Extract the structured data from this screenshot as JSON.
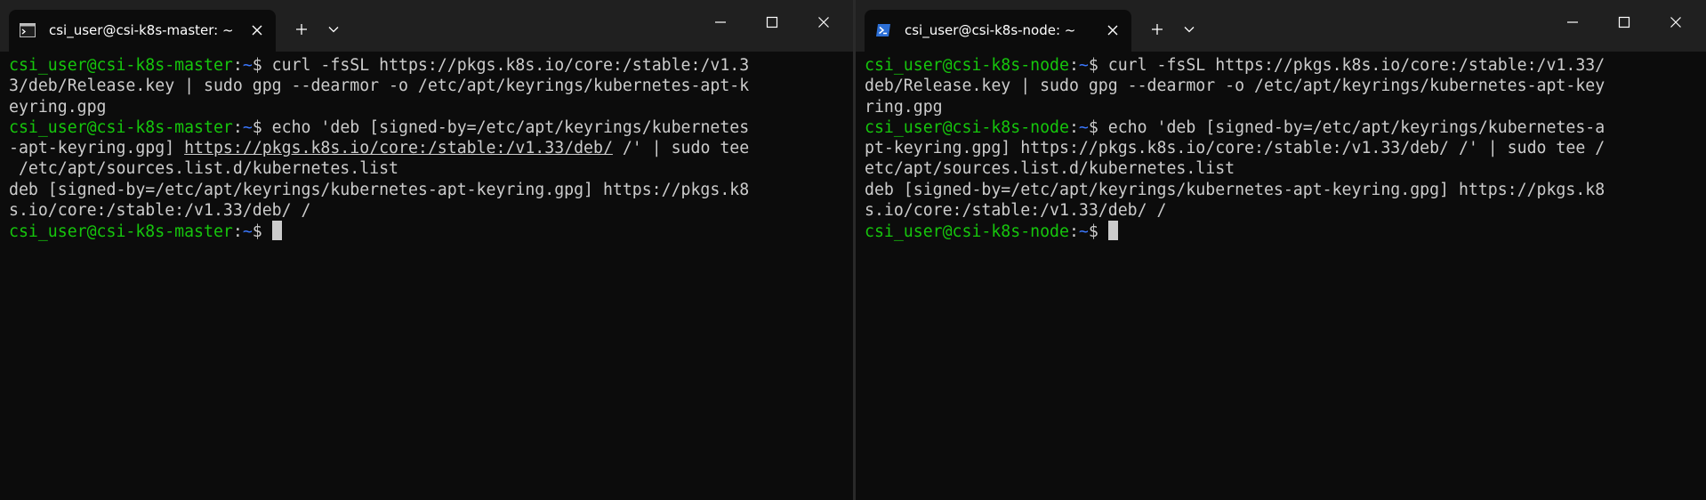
{
  "colors": {
    "background": "#0c0c0c",
    "titlebar": "#202020",
    "prompt_user": "#16c60c",
    "prompt_path": "#3b78ff",
    "text": "#cccccc"
  },
  "left": {
    "tab_title": "csi_user@csi-k8s-master: ~",
    "tab_icon": "terminal-icon",
    "prompt": {
      "user": "csi_user@csi-k8s-master",
      "sep": ":",
      "path": "~",
      "symbol": "$ "
    },
    "lines": [
      {
        "seg": [
          {
            "k": "u",
            "t": "csi_user@csi-k8s-master"
          },
          {
            "k": "w",
            "t": ":"
          },
          {
            "k": "p",
            "t": "~"
          },
          {
            "k": "w",
            "t": "$ curl -fsSL https://pkgs.k8s.io/core:/stable:/v1.3"
          }
        ]
      },
      {
        "seg": [
          {
            "k": "w",
            "t": "3/deb/Release.key | sudo gpg --dearmor -o /etc/apt/keyrings/kubernetes-apt-k"
          }
        ]
      },
      {
        "seg": [
          {
            "k": "w",
            "t": "eyring.gpg"
          }
        ]
      },
      {
        "seg": [
          {
            "k": "u",
            "t": "csi_user@csi-k8s-master"
          },
          {
            "k": "w",
            "t": ":"
          },
          {
            "k": "p",
            "t": "~"
          },
          {
            "k": "w",
            "t": "$ echo 'deb [signed-by=/etc/apt/keyrings/kubernetes"
          }
        ]
      },
      {
        "seg": [
          {
            "k": "w",
            "t": "-apt-keyring.gpg] "
          },
          {
            "k": "l",
            "t": "https://pkgs.k8s.io/core:/stable:/v1.33/deb/"
          },
          {
            "k": "w",
            "t": " /' | sudo tee"
          }
        ]
      },
      {
        "seg": [
          {
            "k": "w",
            "t": " /etc/apt/sources.list.d/kubernetes.list"
          }
        ]
      },
      {
        "seg": [
          {
            "k": "w",
            "t": "deb [signed-by=/etc/apt/keyrings/kubernetes-apt-keyring.gpg] https://pkgs.k8"
          }
        ]
      },
      {
        "seg": [
          {
            "k": "w",
            "t": "s.io/core:/stable:/v1.33/deb/ /"
          }
        ]
      },
      {
        "seg": [
          {
            "k": "u",
            "t": "csi_user@csi-k8s-master"
          },
          {
            "k": "w",
            "t": ":"
          },
          {
            "k": "p",
            "t": "~"
          },
          {
            "k": "w",
            "t": "$"
          }
        ]
      }
    ]
  },
  "right": {
    "tab_title": "csi_user@csi-k8s-node: ~",
    "tab_icon": "powershell-icon",
    "prompt": {
      "user": "csi_user@csi-k8s-node",
      "sep": ":",
      "path": "~",
      "symbol": "$ "
    },
    "lines": [
      {
        "seg": [
          {
            "k": "u",
            "t": "csi_user@csi-k8s-node"
          },
          {
            "k": "w",
            "t": ":"
          },
          {
            "k": "p",
            "t": "~"
          },
          {
            "k": "w",
            "t": "$ curl -fsSL https://pkgs.k8s.io/core:/stable:/v1.33/"
          }
        ]
      },
      {
        "seg": [
          {
            "k": "w",
            "t": "deb/Release.key | sudo gpg --dearmor -o /etc/apt/keyrings/kubernetes-apt-key"
          }
        ]
      },
      {
        "seg": [
          {
            "k": "w",
            "t": "ring.gpg"
          }
        ]
      },
      {
        "seg": [
          {
            "k": "u",
            "t": "csi_user@csi-k8s-node"
          },
          {
            "k": "w",
            "t": ":"
          },
          {
            "k": "p",
            "t": "~"
          },
          {
            "k": "w",
            "t": "$ echo 'deb [signed-by=/etc/apt/keyrings/kubernetes-a"
          }
        ]
      },
      {
        "seg": [
          {
            "k": "w",
            "t": "pt-keyring.gpg] https://pkgs.k8s.io/core:/stable:/v1.33/deb/ /' | sudo tee /"
          }
        ]
      },
      {
        "seg": [
          {
            "k": "w",
            "t": "etc/apt/sources.list.d/kubernetes.list"
          }
        ]
      },
      {
        "seg": [
          {
            "k": "w",
            "t": "deb [signed-by=/etc/apt/keyrings/kubernetes-apt-keyring.gpg] https://pkgs.k8"
          }
        ]
      },
      {
        "seg": [
          {
            "k": "w",
            "t": "s.io/core:/stable:/v1.33/deb/ /"
          }
        ]
      },
      {
        "seg": [
          {
            "k": "u",
            "t": "csi_user@csi-k8s-node"
          },
          {
            "k": "w",
            "t": ":"
          },
          {
            "k": "p",
            "t": "~"
          },
          {
            "k": "w",
            "t": "$"
          }
        ]
      }
    ]
  }
}
